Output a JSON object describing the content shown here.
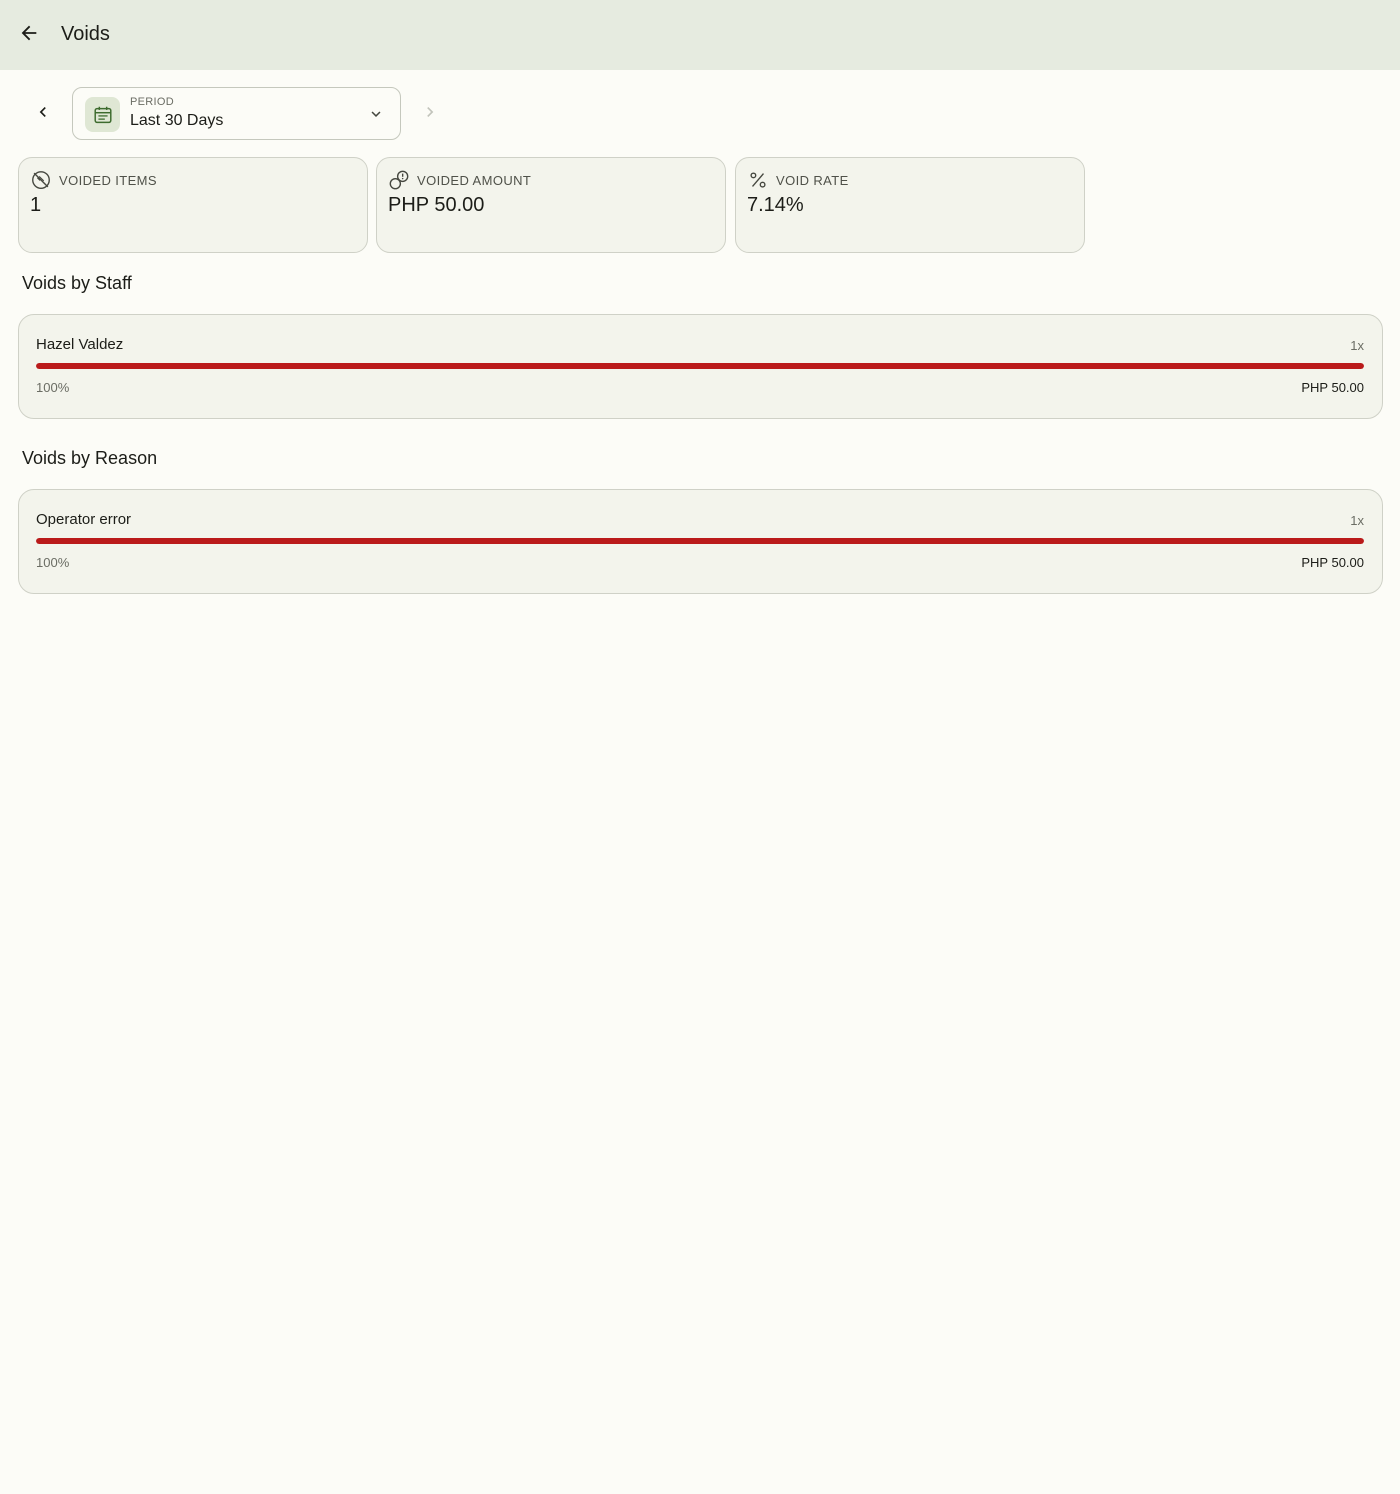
{
  "header": {
    "title": "Voids",
    "back_icon": "arrow-left-icon"
  },
  "period": {
    "label": "PERIOD",
    "value": "Last 30 Days",
    "icon": "calendar-icon",
    "prev_icon": "chevron-left-icon",
    "next_icon": "chevron-right-icon",
    "dropdown_icon": "chevron-down-icon"
  },
  "stats": [
    {
      "label": "VOIDED ITEMS",
      "value": "1",
      "icon": "block-icon"
    },
    {
      "label": "VOIDED AMOUNT",
      "value": "PHP 50.00",
      "icon": "money-off-icon"
    },
    {
      "label": "VOID RATE",
      "value": "7.14%",
      "icon": "percent-icon"
    }
  ],
  "sections": [
    {
      "title": "Voids by Staff",
      "rows": [
        {
          "name": "Hazel Valdez",
          "count": "1x",
          "percent": "100%",
          "fraction": 1.0,
          "amount": "PHP 50.00"
        }
      ]
    },
    {
      "title": "Voids by Reason",
      "rows": [
        {
          "name": "Operator error",
          "count": "1x",
          "percent": "100%",
          "fraction": 1.0,
          "amount": "PHP 50.00"
        }
      ]
    }
  ],
  "colors": {
    "app_bar": "#e6ebe0",
    "background": "#fcfcf7",
    "card": "#f3f4ec",
    "bar_fill": "#ba1a1a",
    "icon_accent": "#3d6b2e"
  }
}
